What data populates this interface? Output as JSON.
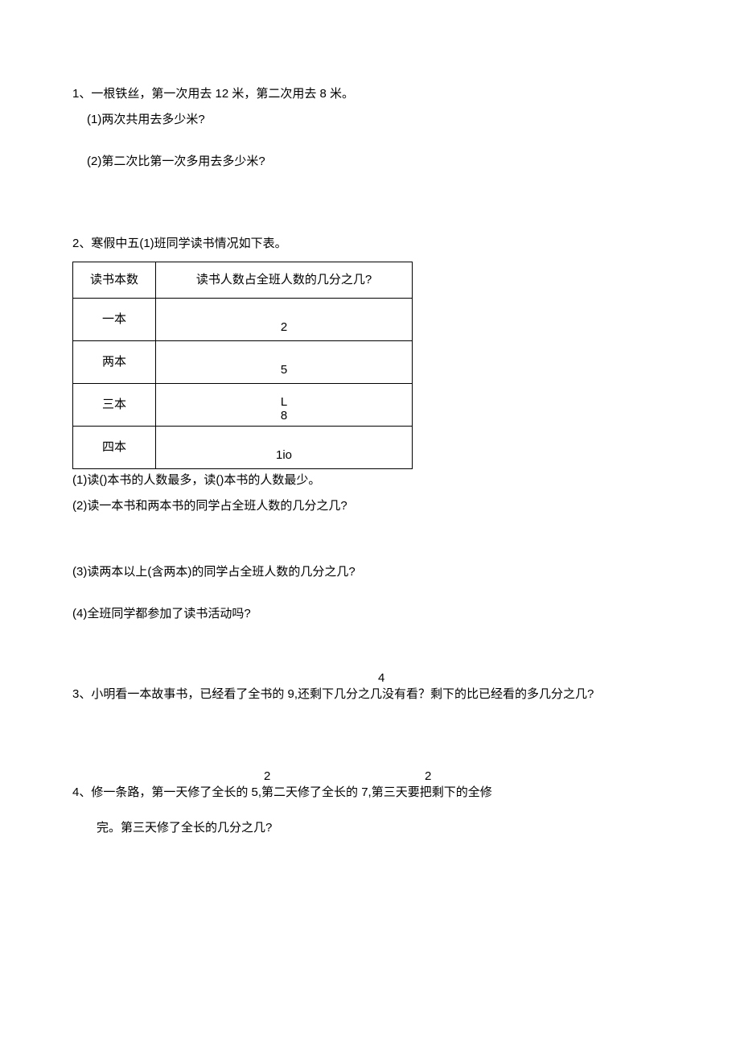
{
  "q1": {
    "stem": "1、一根铁丝，第一次用去 12 米，第二次用去 8 米。",
    "sub1": "(1)两次共用去多少米?",
    "sub2": "(2)第二次比第一次多用去多少米?"
  },
  "q2": {
    "stem": "2、寒假中五(1)班同学读书情况如下表。",
    "table": {
      "h1": "读书本数",
      "h2": "读书人数占全班人数的几分之几?",
      "r1c1": "一本",
      "r1c2": "2",
      "r2c1": "两本",
      "r2c2": "5",
      "r3c1": "三本",
      "r3c2top": "L",
      "r3c2bot": "8",
      "r4c1": "四本",
      "r4c2": "1io"
    },
    "sub1": "(1)读()本书的人数最多，读()本书的人数最少。",
    "sub2": "(2)读一本书和两本书的同学占全班人数的几分之几?",
    "sub3": "(3)读两本以上(含两本)的同学占全班人数的几分之几?",
    "sub4": "(4)全班同学都参加了读书活动吗?"
  },
  "q3": {
    "num": "4",
    "stem": "3、小明看一本故事书，已经看了全书的 9,还剩下几分之几没有看？剩下的比已经看的多几分之几?"
  },
  "q4": {
    "num1": "2",
    "num2": "2",
    "stem": "4、修一条路，第一天修了全长的 5,第二天修了全长的 7,第三天要把剩下的全修",
    "tail": "完。第三天修了全长的几分之几?"
  }
}
